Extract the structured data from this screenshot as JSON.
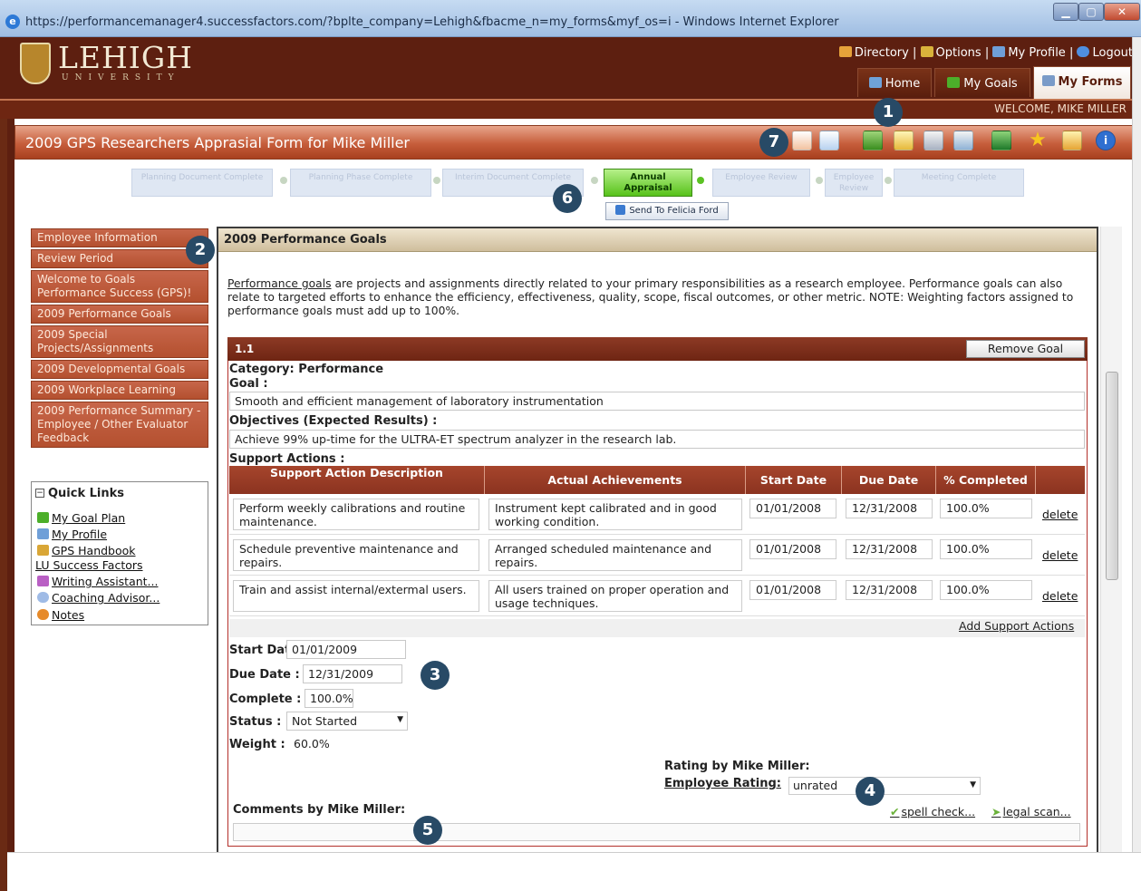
{
  "window": {
    "title": "https://performancemanager4.successfactors.com/?bplte_company=Lehigh&fbacme_n=my_forms&myf_os=i - Windows Internet Explorer",
    "minimize": "▁",
    "maximize": "▢",
    "close": "✕"
  },
  "logo": {
    "name": "LEHIGH",
    "sub": "UNIVERSITY"
  },
  "toplinks": {
    "directory": "Directory",
    "options": "Options",
    "profile": "My Profile",
    "logout": "Logout",
    "sep": "|"
  },
  "tabs": {
    "home": "Home",
    "goals": "My Goals",
    "forms": "My Forms"
  },
  "welcome": "WELCOME, MIKE MILLER",
  "form": {
    "title": "2009 GPS Researchers Apprasial Form for Mike Miller"
  },
  "toolbar": {
    "icons": [
      "layout-icon",
      "window-icon",
      "chart-icon",
      "folder-icon",
      "print-icon",
      "copy-icon",
      "save-icon",
      "star-icon",
      "pencil-icon",
      "info-icon"
    ]
  },
  "steps": {
    "inactive": [
      "Planning Document Complete",
      "Planning Phase Complete",
      "Interim Document Complete",
      "Annual Appraisal",
      "Employee Review",
      "Meeting Complete"
    ],
    "active": "Annual Appraisal",
    "send_button": "Send To Felicia Ford"
  },
  "badges": [
    "1",
    "2",
    "3",
    "4",
    "5",
    "6",
    "7"
  ],
  "leftnav": {
    "items": [
      "Employee Information",
      "Review Period",
      "Welcome to Goals Performance Success (GPS)!",
      "2009 Performance Goals",
      "2009 Special Projects/Assignments",
      "2009 Developmental Goals",
      "2009 Workplace Learning",
      "2009 Performance Summary - Employee / Other Evaluator Feedback"
    ]
  },
  "quicklinks": {
    "title": "Quick Links",
    "toggle": "−",
    "items": [
      "My Goal Plan",
      "My Profile",
      "GPS Handbook",
      "LU Success Factors",
      "Writing Assistant...",
      "Coaching Advisor...",
      "Notes"
    ]
  },
  "section": {
    "title": "2009 Performance Goals",
    "intro_link": "Performance goals",
    "intro_text": " are projects and assignments directly related to your primary responsibilities as a research employee. Performance goals can also relate to targeted efforts to enhance the efficiency, effectiveness, quality, scope, fiscal outcomes, or other metric. NOTE: Weighting factors assigned to performance goals must add up to 100%."
  },
  "goal": {
    "number": "1.1",
    "remove_label": "Remove Goal",
    "category_label": "Category:",
    "category_value": "Performance",
    "goal_label": "Goal :",
    "goal_value": "Smooth and efficient management of laboratory instrumentation",
    "objectives_label": "Objectives (Expected Results) :",
    "objectives_value": "Achieve 99% up-time for the ULTRA-ET spectrum analyzer in the research lab.",
    "support_label": "Support Actions :",
    "start_label": "Start Date :",
    "start_value": "01/01/2009",
    "due_label": "Due Date :",
    "due_value": "12/31/2009",
    "complete_label": "Complete :",
    "complete_value": "100.0%",
    "status_label": "Status :",
    "status_value": "Not Started",
    "weight_label": "Weight :",
    "weight_value": "60.0%"
  },
  "support_table": {
    "headers": [
      "Support Action Description",
      "Actual Achievements",
      "Start Date",
      "Due Date",
      "% Completed"
    ],
    "delete_label": "delete",
    "add_label": "Add Support Actions",
    "rows": [
      {
        "desc": "Perform weekly calibrations and routine maintenance.",
        "ach": "Instrument kept calibrated and in good working condition.",
        "start": "01/01/2008",
        "due": "12/31/2008",
        "pct": "100.0%"
      },
      {
        "desc": "Schedule preventive maintenance and repairs.",
        "ach": "Arranged scheduled maintenance and repairs.",
        "start": "01/01/2008",
        "due": "12/31/2008",
        "pct": "100.0%"
      },
      {
        "desc": "Train and assist internal/extermal users.",
        "ach": "All users trained on proper operation and usage techniques.",
        "start": "01/01/2008",
        "due": "12/31/2008",
        "pct": "100.0%"
      }
    ]
  },
  "rating": {
    "by_label": "Rating by Mike Miller:",
    "employee_label": "Employee Rating:",
    "employee_value": "unrated"
  },
  "comments": {
    "label": "Comments by Mike Miller:",
    "spell": "spell check...",
    "legal": "legal scan..."
  }
}
